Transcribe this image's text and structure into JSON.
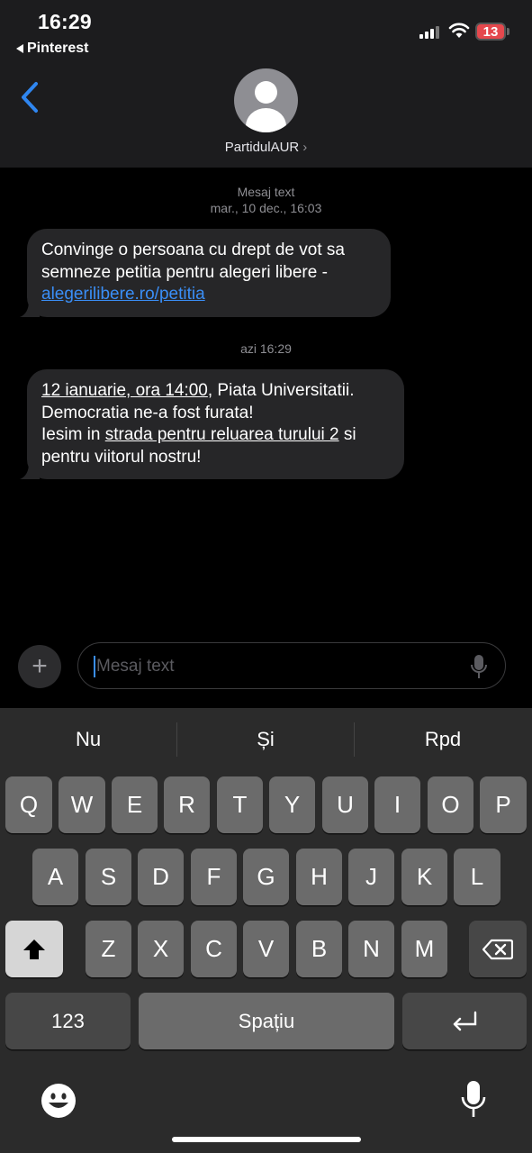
{
  "status": {
    "time": "16:29",
    "back_app": "Pinterest",
    "battery": "13"
  },
  "contact": {
    "name": "PartidulAUR",
    "chevron": "›"
  },
  "messages": [
    {
      "header_label": "Mesaj text",
      "header_time": "mar., 10 dec., 16:03",
      "line1": "Convinge o persoana cu drept de vot sa",
      "line2": "semneze petitia pentru alegeri libere -",
      "link": "alegerilibere.ro/petitia"
    },
    {
      "header_time": "azi 16:29",
      "p1_ul": "12 ianuarie, ora 14:00",
      "p1_rest": ", Piata Universitatii.",
      "line2": "Democratia ne-a fost furata!",
      "line3_a": "Iesim in ",
      "line3_ul": "strada pentru reluarea turului 2",
      "line3_b": " si",
      "line4": "pentru viitorul nostru!"
    }
  ],
  "composer": {
    "plus": "+",
    "placeholder": "Mesaj text"
  },
  "keyboard": {
    "suggestions": [
      "Nu",
      "Și",
      "Rpd"
    ],
    "row1": [
      "Q",
      "W",
      "E",
      "R",
      "T",
      "Y",
      "U",
      "I",
      "O",
      "P"
    ],
    "row2": [
      "A",
      "S",
      "D",
      "F",
      "G",
      "H",
      "J",
      "K",
      "L"
    ],
    "row3": [
      "Z",
      "X",
      "C",
      "V",
      "B",
      "N",
      "M"
    ],
    "numbers": "123",
    "space": "Spațiu"
  },
  "colors": {
    "link": "#3a8ef6",
    "bubble": "#262628",
    "header": "#1c1c1e",
    "keyboard": "#2b2b2b"
  }
}
